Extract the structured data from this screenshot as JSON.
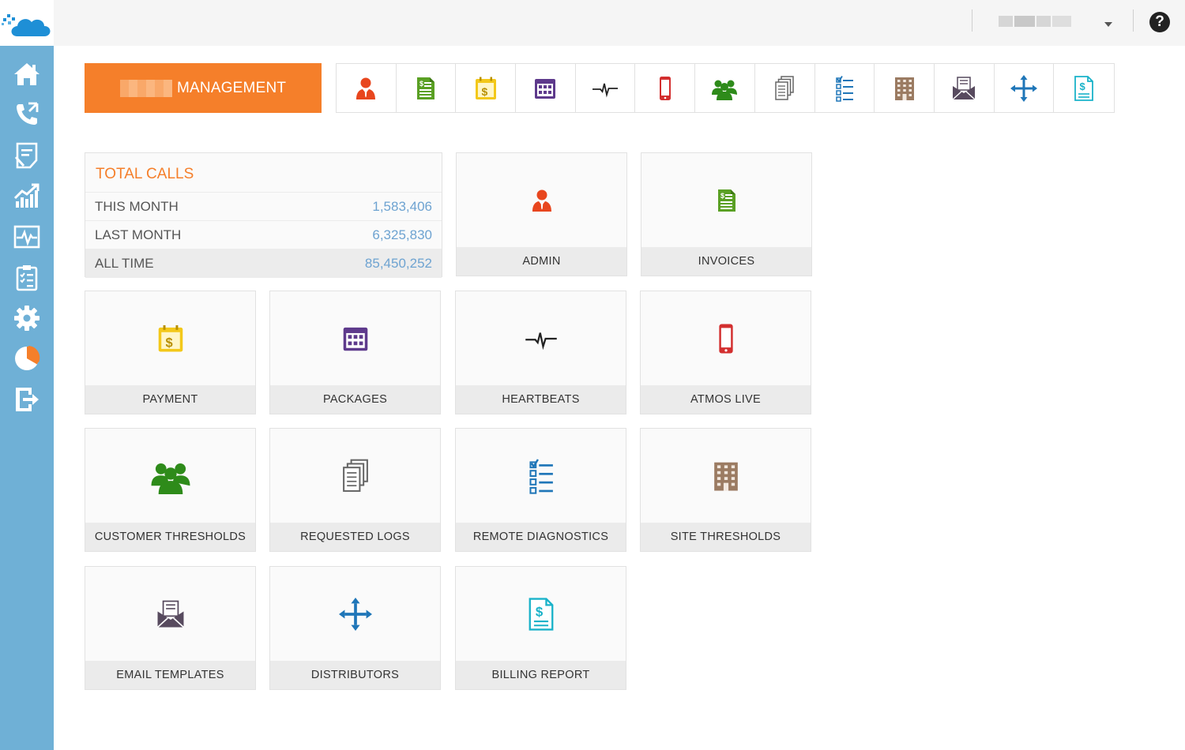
{
  "header": {
    "management_label": "MANAGEMENT",
    "help_label": "?"
  },
  "sidebar": {
    "items": [
      {
        "icon": "home-icon"
      },
      {
        "icon": "phone-icon"
      },
      {
        "icon": "report-icon"
      },
      {
        "icon": "chart-icon"
      },
      {
        "icon": "pulse-icon"
      },
      {
        "icon": "checklist-icon"
      },
      {
        "icon": "gear-icon"
      },
      {
        "icon": "pie-icon"
      },
      {
        "icon": "logout-icon"
      }
    ]
  },
  "toolbar": {
    "items": [
      {
        "icon": "admin-icon"
      },
      {
        "icon": "invoice-icon"
      },
      {
        "icon": "payment-icon"
      },
      {
        "icon": "packages-icon"
      },
      {
        "icon": "heartbeat-icon"
      },
      {
        "icon": "mobile-icon"
      },
      {
        "icon": "group-icon"
      },
      {
        "icon": "logs-icon"
      },
      {
        "icon": "diagnostics-icon"
      },
      {
        "icon": "building-icon"
      },
      {
        "icon": "email-icon"
      },
      {
        "icon": "distributors-icon"
      },
      {
        "icon": "billing-icon"
      }
    ]
  },
  "stats": {
    "title": "TOTAL CALLS",
    "rows": [
      {
        "label": "THIS MONTH",
        "value": "1,583,406"
      },
      {
        "label": "LAST MONTH",
        "value": "6,325,830"
      },
      {
        "label": "ALL TIME",
        "value": "85,450,252"
      }
    ]
  },
  "tiles": [
    {
      "label": "ADMIN",
      "icon": "admin-icon"
    },
    {
      "label": "INVOICES",
      "icon": "invoice-icon"
    },
    {
      "label": "PAYMENT",
      "icon": "payment-icon"
    },
    {
      "label": "PACKAGES",
      "icon": "packages-icon"
    },
    {
      "label": "HEARTBEATS",
      "icon": "heartbeat-icon"
    },
    {
      "label": "ATMOS LIVE",
      "icon": "mobile-icon"
    },
    {
      "label": "CUSTOMER THRESHOLDS",
      "icon": "group-icon"
    },
    {
      "label": "REQUESTED LOGS",
      "icon": "logs-icon"
    },
    {
      "label": "REMOTE DIAGNOSTICS",
      "icon": "diagnostics-icon"
    },
    {
      "label": "SITE THRESHOLDS",
      "icon": "building-icon"
    },
    {
      "label": "EMAIL TEMPLATES",
      "icon": "email-icon"
    },
    {
      "label": "DISTRIBUTORS",
      "icon": "distributors-icon"
    },
    {
      "label": "BILLING REPORT",
      "icon": "billing-icon"
    }
  ],
  "colors": {
    "sidebar": "#6fb0d6",
    "accent": "#f57f2a",
    "value": "#6ea3d1"
  }
}
